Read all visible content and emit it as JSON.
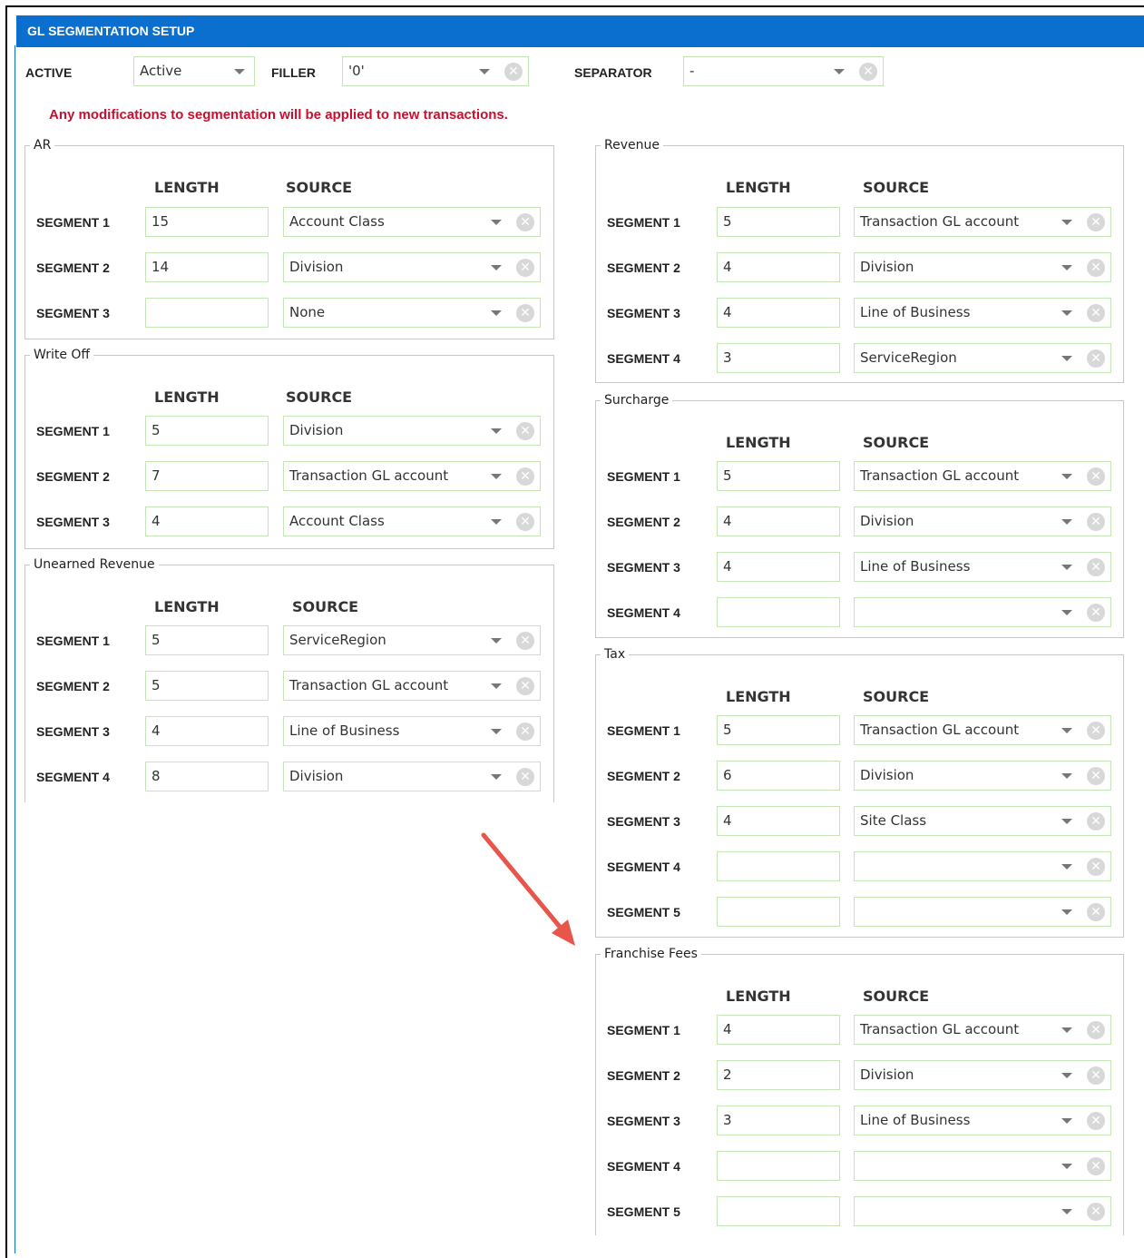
{
  "title": "GL SEGMENTATION SETUP",
  "top": {
    "active_label": "ACTIVE",
    "active_value": "Active",
    "filler_label": "FILLER",
    "filler_value": "'0'",
    "separator_label": "SEPARATOR",
    "separator_value": "-"
  },
  "warning": "Any modifications to segmentation will be applied to new transactions.",
  "colors": {
    "header_blue": "#0a6fcf",
    "warning_red": "#c8102e",
    "field_border": "#c3e6b4",
    "arrow": "#e8554a"
  },
  "headers": {
    "length": "LENGTH",
    "source": "SOURCE"
  },
  "icons": {
    "dropdown": "chevron-down-icon",
    "clear": "clear-x-icon",
    "annotation": "red-arrow"
  },
  "sections": [
    {
      "name": "AR",
      "segments": [
        {
          "label": "SEGMENT 1",
          "length": "15",
          "source": "Account Class"
        },
        {
          "label": "SEGMENT 2",
          "length": "14",
          "source": "Division"
        },
        {
          "label": "SEGMENT 3",
          "length": "",
          "source": "None"
        }
      ]
    },
    {
      "name": "Write Off",
      "segments": [
        {
          "label": "SEGMENT 1",
          "length": "5",
          "source": "Division"
        },
        {
          "label": "SEGMENT 2",
          "length": "7",
          "source": "Transaction GL account"
        },
        {
          "label": "SEGMENT 3",
          "length": "4",
          "source": "Account Class"
        }
      ]
    },
    {
      "name": "Unearned Revenue",
      "segments": [
        {
          "label": "SEGMENT 1",
          "length": "5",
          "source": "ServiceRegion"
        },
        {
          "label": "SEGMENT 2",
          "length": "5",
          "source": "Transaction GL account"
        },
        {
          "label": "SEGMENT 3",
          "length": "4",
          "source": "Line of Business"
        },
        {
          "label": "SEGMENT 4",
          "length": "8",
          "source": "Division"
        }
      ]
    },
    {
      "name": "Revenue",
      "segments": [
        {
          "label": "SEGMENT 1",
          "length": "5",
          "source": "Transaction GL account"
        },
        {
          "label": "SEGMENT 2",
          "length": "4",
          "source": "Division"
        },
        {
          "label": "SEGMENT 3",
          "length": "4",
          "source": "Line of Business"
        },
        {
          "label": "SEGMENT 4",
          "length": "3",
          "source": "ServiceRegion"
        }
      ]
    },
    {
      "name": "Surcharge",
      "segments": [
        {
          "label": "SEGMENT 1",
          "length": "5",
          "source": "Transaction GL account"
        },
        {
          "label": "SEGMENT 2",
          "length": "4",
          "source": "Division"
        },
        {
          "label": "SEGMENT 3",
          "length": "4",
          "source": "Line of Business"
        },
        {
          "label": "SEGMENT 4",
          "length": "",
          "source": ""
        }
      ]
    },
    {
      "name": "Tax",
      "segments": [
        {
          "label": "SEGMENT 1",
          "length": "5",
          "source": "Transaction GL account"
        },
        {
          "label": "SEGMENT 2",
          "length": "6",
          "source": "Division"
        },
        {
          "label": "SEGMENT 3",
          "length": "4",
          "source": "Site Class"
        },
        {
          "label": "SEGMENT 4",
          "length": "",
          "source": ""
        },
        {
          "label": "SEGMENT 5",
          "length": "",
          "source": ""
        }
      ]
    },
    {
      "name": "Franchise Fees",
      "segments": [
        {
          "label": "SEGMENT 1",
          "length": "4",
          "source": "Transaction GL account"
        },
        {
          "label": "SEGMENT 2",
          "length": "2",
          "source": "Division"
        },
        {
          "label": "SEGMENT 3",
          "length": "3",
          "source": "Line of Business"
        },
        {
          "label": "SEGMENT 4",
          "length": "",
          "source": ""
        },
        {
          "label": "SEGMENT 5",
          "length": "",
          "source": ""
        }
      ]
    }
  ]
}
